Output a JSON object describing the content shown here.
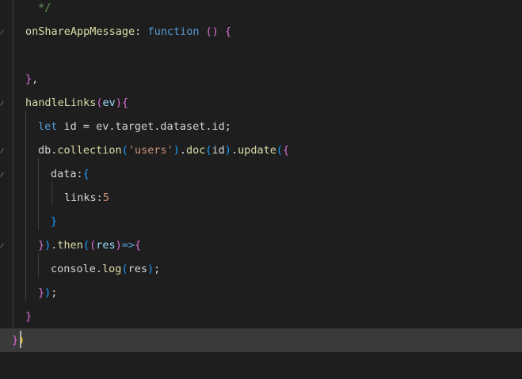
{
  "editor": {
    "colors": {
      "background": "#1e1e1e",
      "current_line": "#3a3a3a",
      "comment": "#6a9955",
      "function_name": "#dcdcaa",
      "keyword": "#569cd6",
      "string": "#ce9178",
      "number": "#b5cea8",
      "variable": "#9cdcfe",
      "bracket_gold": "#ffd700",
      "bracket_purple": "#da70d6",
      "bracket_blue": "#179fff",
      "plain": "#d4d4d4"
    },
    "lines": [
      {
        "name": "line-comment-end",
        "tokens": [
          {
            "text": " */",
            "color": "#6a9955"
          }
        ]
      },
      {
        "name": "line-onshareappmessage",
        "tokens": [
          {
            "text": "onShareAppMessage",
            "color": "#dcdcaa"
          },
          {
            "text": ": ",
            "color": "#d4d4d4"
          },
          {
            "text": "function",
            "color": "#569cd6"
          },
          {
            "text": " ",
            "color": "#d4d4d4"
          },
          {
            "text": "()",
            "color": "#da70d6"
          },
          {
            "text": " ",
            "color": "#d4d4d4"
          },
          {
            "text": "{",
            "color": "#da70d6"
          }
        ]
      },
      {
        "name": "line-empty-1",
        "tokens": []
      },
      {
        "name": "line-empty-2",
        "tokens": []
      },
      {
        "name": "line-close-share",
        "tokens": [
          {
            "text": "}",
            "color": "#da70d6"
          },
          {
            "text": ",",
            "color": "#d4d4d4"
          }
        ]
      },
      {
        "name": "line-handlelinks",
        "tokens": [
          {
            "text": "handleLinks",
            "color": "#dcdcaa"
          },
          {
            "text": "(",
            "color": "#da70d6"
          },
          {
            "text": "ev",
            "color": "#9cdcfe"
          },
          {
            "text": ")",
            "color": "#da70d6"
          },
          {
            "text": "{",
            "color": "#da70d6"
          }
        ]
      },
      {
        "name": "line-let-id",
        "tokens": [
          {
            "text": "let",
            "color": "#569cd6"
          },
          {
            "text": " id = ev.target.dataset.id;",
            "color": "#d4d4d4"
          }
        ]
      },
      {
        "name": "line-db-collection",
        "tokens": [
          {
            "text": "db.",
            "color": "#d4d4d4"
          },
          {
            "text": "collection",
            "color": "#dcdcaa"
          },
          {
            "text": "(",
            "color": "#179fff"
          },
          {
            "text": "'users'",
            "color": "#ce9178"
          },
          {
            "text": ")",
            "color": "#179fff"
          },
          {
            "text": ".",
            "color": "#d4d4d4"
          },
          {
            "text": "doc",
            "color": "#dcdcaa"
          },
          {
            "text": "(",
            "color": "#179fff"
          },
          {
            "text": "id",
            "color": "#d4d4d4"
          },
          {
            "text": ")",
            "color": "#179fff"
          },
          {
            "text": ".",
            "color": "#d4d4d4"
          },
          {
            "text": "update",
            "color": "#dcdcaa"
          },
          {
            "text": "(",
            "color": "#179fff"
          },
          {
            "text": "{",
            "color": "#da70d6"
          }
        ]
      },
      {
        "name": "line-data",
        "tokens": [
          {
            "text": "data",
            "color": "#d4d4d4"
          },
          {
            "text": ":",
            "color": "#d4d4d4"
          },
          {
            "text": "{",
            "color": "#179fff"
          }
        ]
      },
      {
        "name": "line-links",
        "tokens": [
          {
            "text": "links",
            "color": "#d4d4d4"
          },
          {
            "text": ":",
            "color": "#d4d4d4"
          },
          {
            "text": "5",
            "color": "#ce9178"
          }
        ]
      },
      {
        "name": "line-close-data",
        "tokens": [
          {
            "text": "}",
            "color": "#179fff"
          }
        ]
      },
      {
        "name": "line-then",
        "tokens": [
          {
            "text": "}",
            "color": "#da70d6"
          },
          {
            "text": ")",
            "color": "#179fff"
          },
          {
            "text": ".",
            "color": "#d4d4d4"
          },
          {
            "text": "then",
            "color": "#dcdcaa"
          },
          {
            "text": "(",
            "color": "#179fff"
          },
          {
            "text": "(",
            "color": "#da70d6"
          },
          {
            "text": "res",
            "color": "#9cdcfe"
          },
          {
            "text": ")",
            "color": "#da70d6"
          },
          {
            "text": "=>",
            "color": "#569cd6"
          },
          {
            "text": "{",
            "color": "#da70d6"
          }
        ]
      },
      {
        "name": "line-console-log",
        "tokens": [
          {
            "text": "console.",
            "color": "#d4d4d4"
          },
          {
            "text": "log",
            "color": "#dcdcaa"
          },
          {
            "text": "(",
            "color": "#179fff"
          },
          {
            "text": "res",
            "color": "#d4d4d4"
          },
          {
            "text": ")",
            "color": "#179fff"
          },
          {
            "text": ";",
            "color": "#d4d4d4"
          }
        ]
      },
      {
        "name": "line-close-then",
        "tokens": [
          {
            "text": "}",
            "color": "#da70d6"
          },
          {
            "text": ")",
            "color": "#179fff"
          },
          {
            "text": ";",
            "color": "#d4d4d4"
          }
        ]
      },
      {
        "name": "line-close-handlelinks",
        "tokens": [
          {
            "text": "}",
            "color": "#da70d6"
          }
        ]
      },
      {
        "name": "line-close-page",
        "tokens": [
          {
            "text": "}",
            "color": "#da70d6"
          },
          {
            "text": ")",
            "color": "#ffd700"
          }
        ]
      }
    ]
  }
}
